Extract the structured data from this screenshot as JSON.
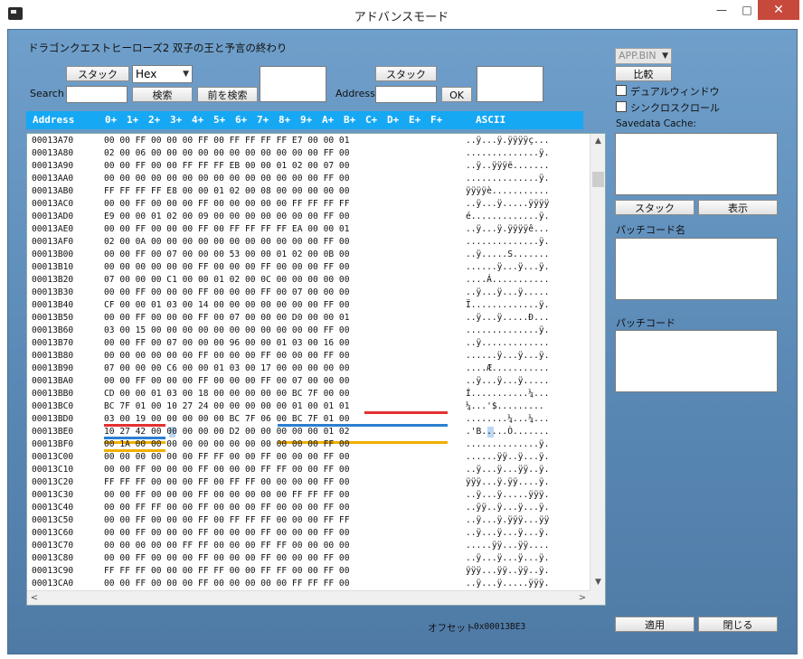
{
  "window": {
    "title": "アドバンスモード",
    "minimize": "—",
    "maximize": "□",
    "close": "✕"
  },
  "game_title": "ドラゴンクエストヒーローズ2 双子の王と予言の終わり",
  "toolbar": {
    "stack_label": "スタック",
    "search_label": "Search",
    "type_select": "Hex",
    "search_button": "検索",
    "prev_search_button": "前を検索",
    "address_stack_label": "スタック",
    "address_label": "Address",
    "ok_button": "OK"
  },
  "right_panel": {
    "file_select": "APP.BIN",
    "compare_button": "比較",
    "dual_window_label": "デュアルウィンドウ",
    "sync_scroll_label": "シンクロスクロール",
    "savedata_cache_label": "Savedata Cache:",
    "stack_button": "スタック",
    "display_button": "表示",
    "patch_name_label": "パッチコード名",
    "patch_code_label": "パッチコード",
    "apply_button": "適用",
    "close_button": "閉じる"
  },
  "status": {
    "offset_label": "オフセット",
    "offset_value": "0x00013BE3"
  },
  "hex": {
    "header": {
      "address": "Address",
      "cols": [
        "0+",
        "1+",
        "2+",
        "3+",
        "4+",
        "5+",
        "6+",
        "7+",
        "8+",
        "9+",
        "A+",
        "B+",
        "C+",
        "D+",
        "E+",
        "F+"
      ],
      "ascii": "ASCII"
    },
    "rows": [
      {
        "addr": "00013A70",
        "bytes": "00 00 FF 00 00 00 FF 00 FF FF FF FF E7 00 00 01",
        "ascii": "..ÿ...ÿ.ÿÿÿÿç..."
      },
      {
        "addr": "00013A80",
        "bytes": "02 00 06 00 00 00 00 00 00 00 00 00 00 00 FF 00",
        "ascii": "..............ÿ."
      },
      {
        "addr": "00013A90",
        "bytes": "00 00 FF 00 00 FF FF FF EB 00 00 01 02 00 07 00",
        "ascii": "..ÿ..ÿÿÿë......."
      },
      {
        "addr": "00013AA0",
        "bytes": "00 00 00 00 00 00 00 00 00 00 00 00 00 00 FF 00",
        "ascii": "..............ÿ."
      },
      {
        "addr": "00013AB0",
        "bytes": "FF FF FF FF E8 00 00 01 02 00 08 00 00 00 00 00",
        "ascii": "ÿÿÿÿè..........."
      },
      {
        "addr": "00013AC0",
        "bytes": "00 00 FF 00 00 00 FF 00 00 00 00 00 FF FF FF FF",
        "ascii": "..ÿ...ÿ.....ÿÿÿÿ"
      },
      {
        "addr": "00013AD0",
        "bytes": "E9 00 00 01 02 00 09 00 00 00 00 00 00 00 FF 00",
        "ascii": "é.............ÿ."
      },
      {
        "addr": "00013AE0",
        "bytes": "00 00 FF 00 00 00 FF 00 FF FF FF FF EA 00 00 01",
        "ascii": "..ÿ...ÿ.ÿÿÿÿê..."
      },
      {
        "addr": "00013AF0",
        "bytes": "02 00 0A 00 00 00 00 00 00 00 00 00 00 00 FF 00",
        "ascii": "..............ÿ."
      },
      {
        "addr": "00013B00",
        "bytes": "00 00 FF 00 07 00 00 00 53 00 00 01 02 00 0B 00",
        "ascii": "..ÿ.....S......."
      },
      {
        "addr": "00013B10",
        "bytes": "00 00 00 00 00 00 FF 00 00 00 FF 00 00 00 FF 00",
        "ascii": "......ÿ...ÿ...ÿ."
      },
      {
        "addr": "00013B20",
        "bytes": "07 00 00 00 C1 00 00 01 02 00 0C 00 00 00 00 00",
        "ascii": "....Á..........."
      },
      {
        "addr": "00013B30",
        "bytes": "00 00 FF 00 00 00 FF 00 00 00 FF 00 07 00 00 00",
        "ascii": "..ÿ...ÿ...ÿ....."
      },
      {
        "addr": "00013B40",
        "bytes": "CF 00 00 01 03 00 14 00 00 00 00 00 00 00 FF 00",
        "ascii": "Ï.............ÿ."
      },
      {
        "addr": "00013B50",
        "bytes": "00 00 FF 00 00 00 FF 00 07 00 00 00 D0 00 00 01",
        "ascii": "..ÿ...ÿ.....Ð..."
      },
      {
        "addr": "00013B60",
        "bytes": "03 00 15 00 00 00 00 00 00 00 00 00 00 00 FF 00",
        "ascii": "..............ÿ."
      },
      {
        "addr": "00013B70",
        "bytes": "00 00 FF 00 07 00 00 00 96 00 00 01 03 00 16 00",
        "ascii": "..ÿ............."
      },
      {
        "addr": "00013B80",
        "bytes": "00 00 00 00 00 00 FF 00 00 00 FF 00 00 00 FF 00",
        "ascii": "......ÿ...ÿ...ÿ."
      },
      {
        "addr": "00013B90",
        "bytes": "07 00 00 00 C6 00 00 01 03 00 17 00 00 00 00 00",
        "ascii": "....Æ..........."
      },
      {
        "addr": "00013BA0",
        "bytes": "00 00 FF 00 00 00 FF 00 00 00 FF 00 07 00 00 00",
        "ascii": "..ÿ...ÿ...ÿ....."
      },
      {
        "addr": "00013BB0",
        "bytes": "CD 00 00 01 03 00 18 00 00 00 00 00 BC 7F 00 00",
        "ascii": "Í...........¼..."
      },
      {
        "addr": "00013BC0",
        "bytes": "BC 7F 01 00 10 27 24 00 00 00 00 00 01 00 01 01",
        "ascii": "¼...'$........."
      },
      {
        "addr": "00013BD0",
        "bytes": "03 00 19 00 00 00 00 00 BC 7F 06 00 BC 7F 01 00",
        "ascii": "........¼...¼..."
      },
      {
        "addr": "00013BE0",
        "bytes": "10 27 42 00 00 00 00 00 D2 00 00 00 00 00 01 02",
        "ascii": ".'B.....Ò......."
      },
      {
        "addr": "00013BF0",
        "bytes": "00 1A 00 00 00 00 00 00 00 00 00 00 00 00 FF 00",
        "ascii": "..............ÿ."
      },
      {
        "addr": "00013C00",
        "bytes": "00 00 00 00 00 00 FF FF 00 00 FF 00 00 00 FF 00",
        "ascii": "......ÿÿ..ÿ...ÿ."
      },
      {
        "addr": "00013C10",
        "bytes": "00 00 FF 00 00 00 FF 00 00 00 FF FF 00 00 FF 00",
        "ascii": "..ÿ...ÿ...ÿÿ..ÿ."
      },
      {
        "addr": "00013C20",
        "bytes": "FF FF FF 00 00 00 FF 00 FF FF 00 00 00 00 FF 00",
        "ascii": "ÿÿÿ...ÿ.ÿÿ....ÿ."
      },
      {
        "addr": "00013C30",
        "bytes": "00 00 FF 00 00 00 FF 00 00 00 00 00 FF FF FF 00",
        "ascii": "..ÿ...ÿ.....ÿÿÿ."
      },
      {
        "addr": "00013C40",
        "bytes": "00 00 FF FF 00 00 FF 00 00 00 FF 00 00 00 FF 00",
        "ascii": "..ÿÿ..ÿ...ÿ...ÿ."
      },
      {
        "addr": "00013C50",
        "bytes": "00 00 FF 00 00 00 FF 00 FF FF FF 00 00 00 FF FF",
        "ascii": "..ÿ...ÿ.ÿÿÿ...ÿÿ"
      },
      {
        "addr": "00013C60",
        "bytes": "00 00 FF 00 00 00 FF 00 00 00 FF 00 00 00 FF 00",
        "ascii": "..ÿ...ÿ...ÿ...ÿ."
      },
      {
        "addr": "00013C70",
        "bytes": "00 00 00 00 00 FF FF 00 00 00 FF FF 00 00 00 00",
        "ascii": ".....ÿÿ...ÿÿ...."
      },
      {
        "addr": "00013C80",
        "bytes": "00 00 FF 00 00 00 FF 00 00 00 FF 00 00 00 FF 00",
        "ascii": "..ÿ...ÿ...ÿ...ÿ."
      },
      {
        "addr": "00013C90",
        "bytes": "FF FF FF 00 00 00 FF FF 00 00 FF FF 00 00 FF 00",
        "ascii": "ÿÿÿ...ÿÿ..ÿÿ..ÿ."
      },
      {
        "addr": "00013CA0",
        "bytes": "00 00 FF 00 00 00 FF 00 00 00 00 00 FF FF FF 00",
        "ascii": "..ÿ...ÿ.....ÿÿÿ."
      }
    ]
  }
}
